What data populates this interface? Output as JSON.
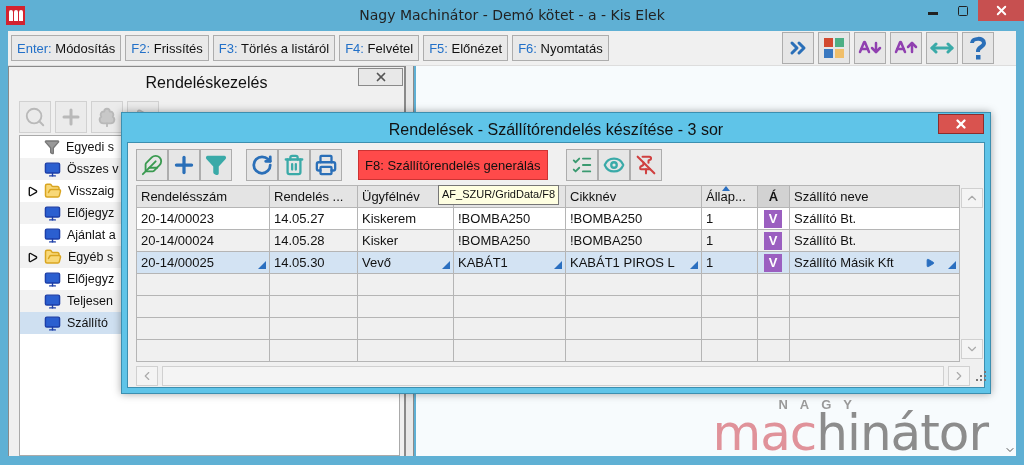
{
  "window": {
    "title": "Nagy Machinátor - Demó kötet - a - Kis Elek"
  },
  "toolbar": {
    "buttons": [
      {
        "key": "Enter:",
        "label": "Módosítás"
      },
      {
        "key": "F2:",
        "label": "Frissítés"
      },
      {
        "key": "F3:",
        "label": "Törlés a listáról"
      },
      {
        "key": "F4:",
        "label": "Felvétel"
      },
      {
        "key": "F5:",
        "label": "Előnézet"
      },
      {
        "key": "F6:",
        "label": "Nyomtatás"
      }
    ]
  },
  "left_panel": {
    "title": "Rendeléskezelés",
    "tree": [
      {
        "label": "Egyedi s",
        "kind": "filter",
        "expandable": false,
        "selected": false
      },
      {
        "label": "Összes v",
        "kind": "view",
        "expandable": false,
        "selected": false
      },
      {
        "label": "Visszaig",
        "kind": "folder",
        "expandable": true,
        "selected": false
      },
      {
        "label": "Előjegyz",
        "kind": "view",
        "expandable": false,
        "selected": false
      },
      {
        "label": "Ajánlat a",
        "kind": "view",
        "expandable": false,
        "selected": false
      },
      {
        "label": "Egyéb s",
        "kind": "folder",
        "expandable": true,
        "selected": false
      },
      {
        "label": "Előjegyz",
        "kind": "view",
        "expandable": false,
        "selected": false
      },
      {
        "label": "Teljesen",
        "kind": "view",
        "expandable": false,
        "selected": false
      },
      {
        "label": "Szállító",
        "kind": "view",
        "expandable": false,
        "selected": true
      }
    ]
  },
  "dialog": {
    "title": "Rendelések - Szállítórendelés készítése - 3 sor",
    "primary_button": "F8: Szállítórendelés generálás",
    "grid": {
      "tooltip": "AF_SZUR/GridData/F8",
      "columns": [
        {
          "label": "Rendelésszám",
          "kind": "combo"
        },
        {
          "label": "Rendelés ...",
          "kind": "plain"
        },
        {
          "label": "Ügyfélnév",
          "kind": "combo"
        },
        {
          "kind": "combo"
        },
        {
          "label": "Cikknév",
          "kind": "combo"
        },
        {
          "label": "Állap...",
          "kind": "plain",
          "sorted": true
        },
        {
          "label": "Á",
          "kind": "status"
        },
        {
          "label": "Szállító neve",
          "kind": "lookup"
        }
      ],
      "rows": [
        {
          "selected": false,
          "cells": [
            "20-14/00023",
            "14.05.27",
            "Kiskerem",
            "!BOMBA250",
            "!BOMBA250",
            "1",
            "V",
            "Szállító Bt."
          ]
        },
        {
          "selected": false,
          "cells": [
            "20-14/00024",
            "14.05.28",
            "Kisker",
            "!BOMBA250",
            "!BOMBA250",
            "1",
            "V",
            "Szállító Bt."
          ]
        },
        {
          "selected": true,
          "cells": [
            "20-14/00025",
            "14.05.30",
            "Vevő",
            "KABÁT1",
            "KABÁT1 PIROS L",
            "1",
            "V",
            "Szállító Másik Kft"
          ]
        }
      ]
    }
  },
  "logo": {
    "top": "NAGY",
    "part_1": "mac",
    "part_2": "hinátor"
  }
}
